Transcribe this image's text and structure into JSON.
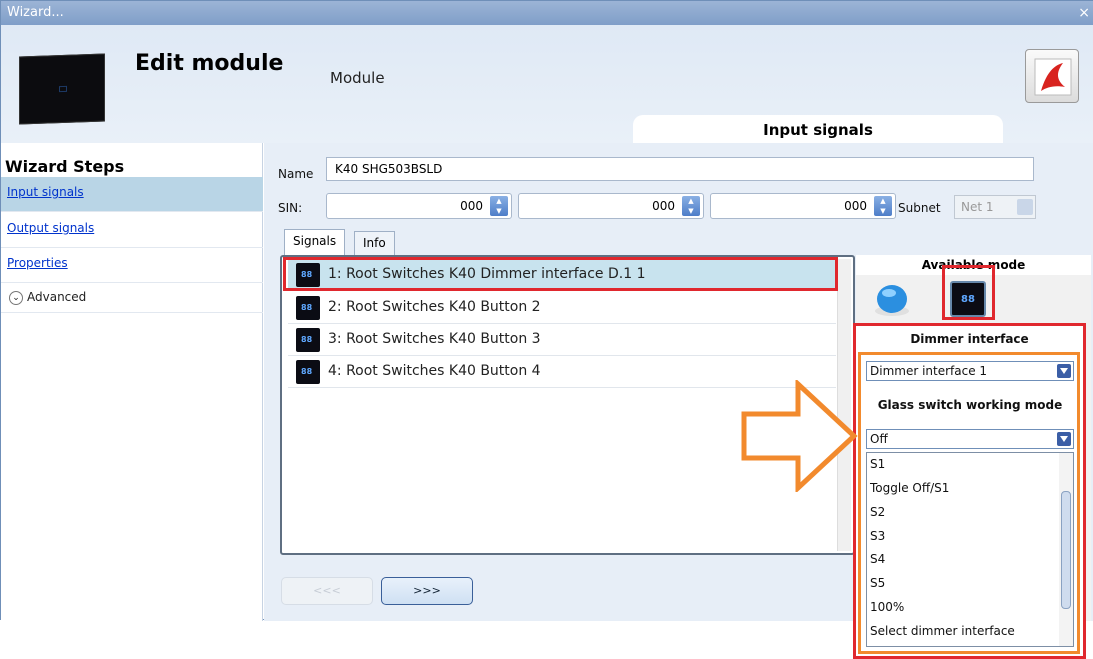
{
  "window": {
    "title": "Wizard...",
    "close": "×"
  },
  "header": {
    "title": "Edit module",
    "subtitle": "Module",
    "section_tab": "Input signals",
    "pdf_icon": "pdf-icon"
  },
  "sidebar": {
    "title": "Wizard Steps",
    "items": [
      {
        "label": "Input signals"
      },
      {
        "label": "Output signals"
      },
      {
        "label": "Properties"
      }
    ],
    "advanced": "Advanced"
  },
  "form": {
    "name_label": "Name",
    "name_value": "K40 SHG503BSLD",
    "sin_label": "SIN:",
    "sin_values": [
      "000",
      "000",
      "000"
    ],
    "subnet_label": "Subnet",
    "subnet_value": "Net 1"
  },
  "tabs": [
    {
      "label": "Signals"
    },
    {
      "label": "Info"
    }
  ],
  "signals": [
    {
      "label": "1: Root Switches K40 Dimmer interface D.1 1",
      "icon": "88"
    },
    {
      "label": "2: Root Switches K40 Button 2",
      "icon": "88"
    },
    {
      "label": "3: Root Switches K40 Button 3",
      "icon": "88"
    },
    {
      "label": "4: Root Switches K40 Button 4",
      "icon": "88"
    }
  ],
  "available": {
    "title": "Available mode",
    "mode_icon_label": "88",
    "mode_title": "Dimmer interface",
    "dimmer_select": "Dimmer interface 1",
    "glass_title": "Glass switch working mode",
    "glass_select": "Off",
    "options": [
      "S1",
      "Toggle Off/S1",
      "S2",
      "S3",
      "S4",
      "S5",
      "100%",
      "Select dimmer interface"
    ]
  },
  "nav": {
    "prev": "<<<",
    "next": ">>>"
  },
  "colors": {
    "highlight_red": "#e0282e",
    "highlight_orange": "#f28a2d",
    "selected_row": "#c8e3ee"
  }
}
